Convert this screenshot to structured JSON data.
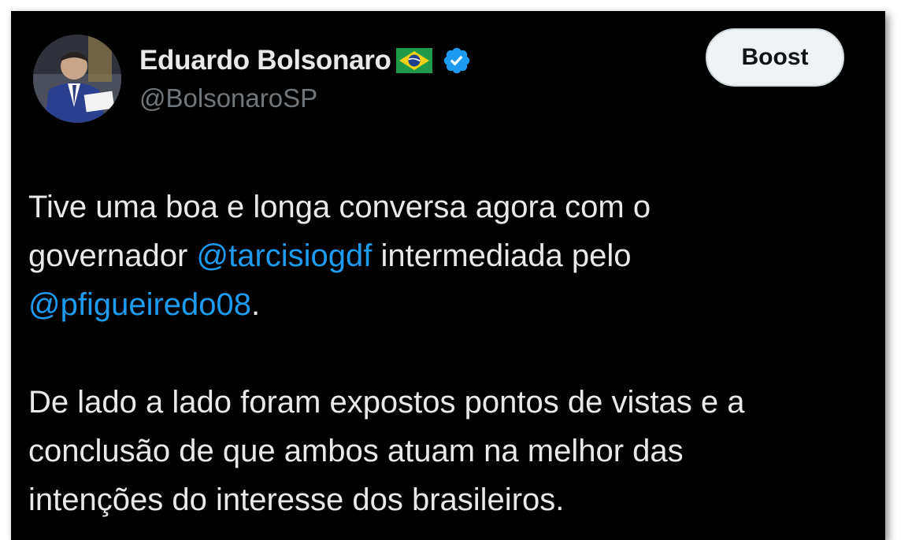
{
  "author": {
    "name": "Eduardo Bolsonaro",
    "handle": "@BolsonaroSP",
    "flag_icon": "brazil-flag-icon",
    "verified_icon": "verified-badge-icon",
    "verified_color": "#1d9bf0"
  },
  "actions": {
    "boost_label": "Boost"
  },
  "tweet": {
    "p1_line1": "Tive uma boa e longa conversa agora com o",
    "p1_line2_pre": "governador ",
    "mention1": "@tarcisiogdf",
    "p1_line2_post": " intermediada pelo",
    "mention2": "@pfigueiredo08",
    "p1_line3_post": ".",
    "p2_line1": "De lado a lado foram expostos pontos de vistas e a",
    "p2_line2": "conclusão de que ambos atuam na melhor das",
    "p2_line3": "intenções do interesse dos brasileiros."
  },
  "colors": {
    "background": "#000000",
    "text": "#e7e9ea",
    "secondary_text": "#71767b",
    "link": "#1d9bf0"
  }
}
